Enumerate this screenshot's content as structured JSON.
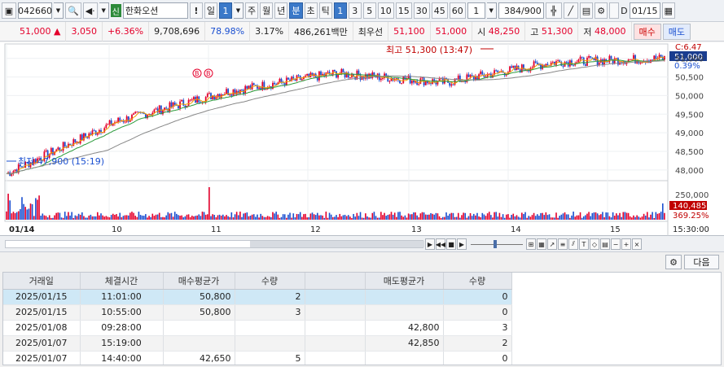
{
  "toolbar": {
    "code": "042660",
    "badge": "신",
    "name": "한화오션",
    "warn": "!",
    "period_day": "일",
    "period_num": "1",
    "periods": [
      "주",
      "월",
      "년",
      "분",
      "초",
      "틱"
    ],
    "intervals": [
      "1",
      "3",
      "5",
      "10",
      "15",
      "30",
      "45",
      "60"
    ],
    "unit_value": "1",
    "count": "384/900",
    "d_label": "D",
    "date": "01/15"
  },
  "quote": {
    "price": "51,000",
    "arrow": "▲",
    "change": "3,050",
    "pct": "+6.36%",
    "volume": "9,708,696",
    "vol_ratio": "78.98%",
    "turnover": "3.17%",
    "amount": "486,261백만",
    "best_sell_label": "최우선",
    "best_sell": "51,100",
    "best_buy": "51,000",
    "open_label": "시",
    "open": "48,250",
    "high_label": "고",
    "high": "51,300",
    "low_label": "저",
    "low": "48,000",
    "buy_btn": "매수",
    "sell_btn": "매도"
  },
  "chart": {
    "legend_c": "C:6.47",
    "current_price": "51,000",
    "current_pct": "0.39%",
    "high_note": "최고 51,300 (13:47)",
    "low_note": "최저 47,900 (15:19)",
    "buy_markers": [
      "B",
      "B"
    ],
    "price_ticks": [
      "51,000",
      "50,500",
      "50,000",
      "49,500",
      "49,000",
      "48,500",
      "48,000"
    ],
    "volume_ticks": [
      "250,000",
      "140,485",
      "369.25%"
    ],
    "date_labels": [
      "01/14",
      "10",
      "11",
      "12",
      "13",
      "14",
      "15"
    ],
    "end_time": "15:30:00",
    "colors": {
      "up": "#e4002b",
      "down": "#1a4fd0",
      "ma5": "#f0a000",
      "ma20": "#2a9a3a",
      "ma60": "#888888"
    }
  },
  "chart_data": {
    "type": "line",
    "title": "",
    "xlabel": "",
    "ylabel": "",
    "ylim": [
      47800,
      51300
    ],
    "x": [
      "01/14",
      "10",
      "11",
      "12",
      "13",
      "14",
      "15"
    ],
    "series": [
      {
        "values": [
          47900,
          49300,
          50100,
          50600,
          50350,
          50900,
          51000
        ]
      }
    ]
  },
  "nav": {
    "zoom_minus": "−",
    "zoom_plus": "+",
    "close": "×"
  },
  "panel": {
    "next_btn": "다음",
    "columns": [
      "거래일",
      "체결시간",
      "매수평균가",
      "수량",
      "",
      "매도평균가",
      "수량"
    ],
    "rows": [
      [
        "2025/01/15",
        "11:01:00",
        "50,800",
        "2",
        "",
        "",
        "0"
      ],
      [
        "2025/01/15",
        "10:55:00",
        "50,800",
        "3",
        "",
        "",
        "0"
      ],
      [
        "2025/01/08",
        "09:28:00",
        "",
        "",
        "",
        "42,800",
        "3"
      ],
      [
        "2025/01/07",
        "15:19:00",
        "",
        "",
        "",
        "42,850",
        "2"
      ],
      [
        "2025/01/07",
        "14:40:00",
        "42,650",
        "5",
        "",
        "",
        "0"
      ]
    ]
  }
}
